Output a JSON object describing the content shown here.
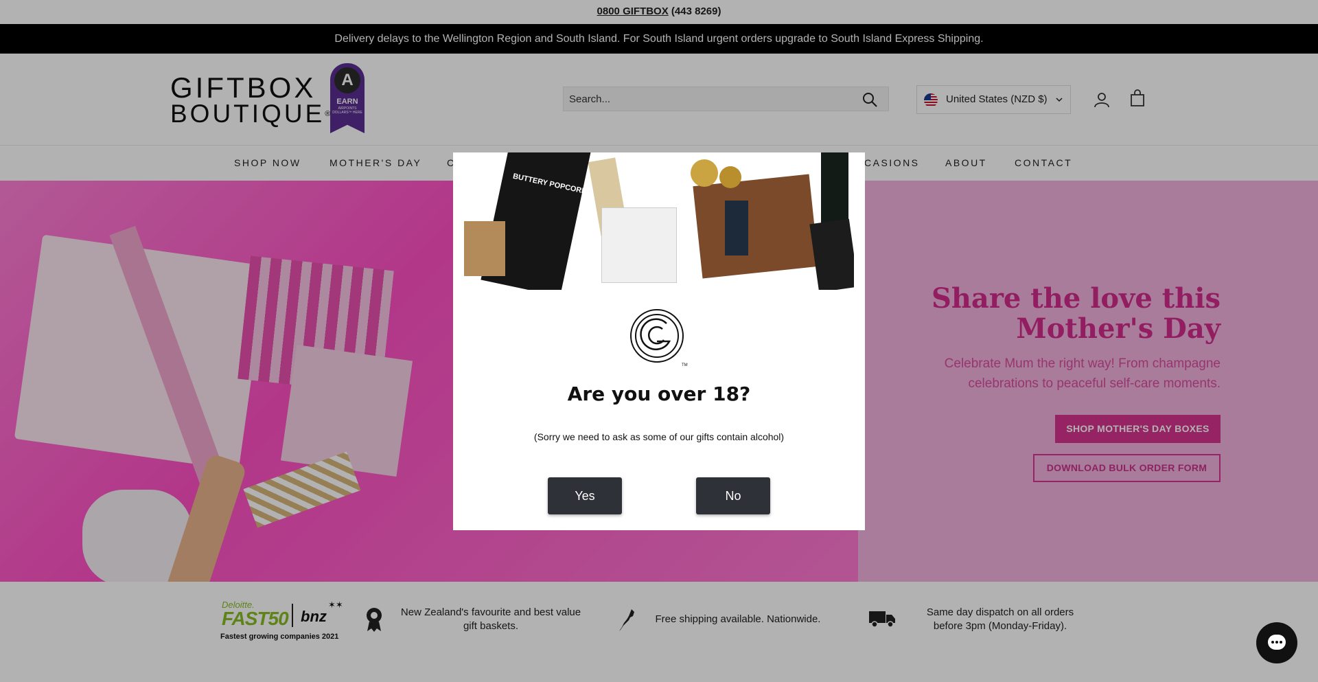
{
  "topbar": {
    "phone": "0800 GIFTBOX",
    "phone_digits": "(443 8269)"
  },
  "announcement": "Delivery delays to the Wellington Region and South Island. For South Island urgent orders upgrade to South Island Express Shipping.",
  "header": {
    "logo_line1": "GIFTBOX",
    "logo_line2": "BOUTIQUE",
    "logo_reg": "®",
    "badge_letter": "A",
    "badge_earn": "EARN",
    "badge_small": "AIRPOINTS DOLLARS™ HERE",
    "search_placeholder": "Search...",
    "currency": "United States (NZD $)"
  },
  "nav": {
    "items": [
      "SHOP NOW",
      "MOTHER'S DAY",
      "C",
      "CASIONS",
      "ABOUT",
      "CONTACT"
    ]
  },
  "hero": {
    "title_line1": "Share the love this",
    "title_line2": "Mother's Day",
    "subtitle_line1": "Celebrate Mum the right way! From champagne",
    "subtitle_line2": "celebrations to peaceful self-care moments.",
    "primary_button": "SHOP MOTHER'S DAY BOXES",
    "secondary_button": "DOWNLOAD BULK ORDER FORM"
  },
  "usp": {
    "deloitte_brand": "Deloitte.",
    "fast50": "FAST50",
    "bnz": "bnz",
    "award_caption": "Fastest growing companies 2021",
    "item1_line1": "New Zealand's favourite and best value",
    "item1_line2": "gift baskets.",
    "item2": "Free shipping available. Nationwide.",
    "item3_line1": "Same day dispatch on all orders",
    "item3_line2": "before 3pm (Monday-Friday)."
  },
  "modal": {
    "logo_tm": "TM",
    "image_text": "BUTTERY POPCORN",
    "title": "Are you over 18?",
    "note": "(Sorry we need to ask as some of our gifts contain alcohol)",
    "yes_label": "Yes",
    "no_label": "No"
  },
  "colors": {
    "accent_pink": "#d7338f",
    "hero_title": "#d22a8b",
    "announcement_bg": "#000000",
    "modal_button": "#2e3137"
  },
  "icons": [
    "search-icon",
    "account-icon",
    "cart-icon",
    "chevron-down-icon",
    "award-icon",
    "nz-map-icon",
    "truck-icon",
    "chat-icon"
  ]
}
